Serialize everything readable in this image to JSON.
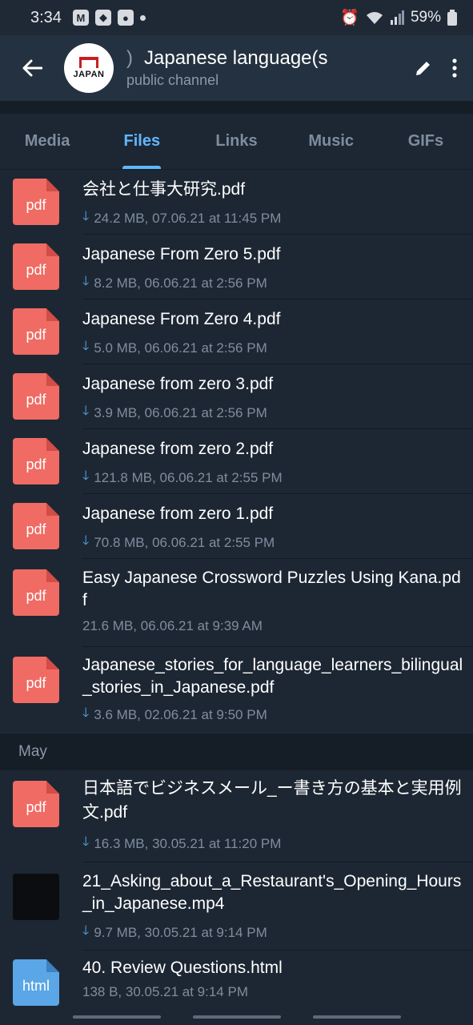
{
  "status": {
    "time": "3:34",
    "battery": "59%"
  },
  "channel": {
    "avatar_text": "JAPAN",
    "title_prefix": ")",
    "title": "Japanese language(s",
    "subtitle": "public channel"
  },
  "tabs": [
    {
      "label": "Media"
    },
    {
      "label": "Files"
    },
    {
      "label": "Links"
    },
    {
      "label": "Music"
    },
    {
      "label": "GIFs"
    }
  ],
  "files": [
    {
      "name": "会社と仕事大研究.pdf",
      "meta": "24.2 MB, 07.06.21 at 11:45 PM",
      "icon": "pdf"
    },
    {
      "name": "Japanese From Zero 5.pdf",
      "meta": "8.2 MB, 06.06.21 at 2:56 PM",
      "icon": "pdf"
    },
    {
      "name": "Japanese From Zero 4.pdf",
      "meta": "5.0 MB, 06.06.21 at 2:56 PM",
      "icon": "pdf"
    },
    {
      "name": "Japanese from zero 3.pdf",
      "meta": "3.9 MB, 06.06.21 at 2:56 PM",
      "icon": "pdf"
    },
    {
      "name": "Japanese from zero 2.pdf",
      "meta": "121.8 MB, 06.06.21 at 2:55 PM",
      "icon": "pdf"
    },
    {
      "name": "Japanese from zero 1.pdf",
      "meta": "70.8 MB, 06.06.21 at 2:55 PM",
      "icon": "pdf"
    },
    {
      "name": "Easy Japanese Crossword Puzzles Using Kana.pdf",
      "meta": "21.6 MB, 06.06.21 at 9:39 AM",
      "icon": "pdf"
    },
    {
      "name": "Japanese_stories_for_language_learners_bilingual_stories_in_Japanese.pdf",
      "meta": "3.6 MB, 02.06.21 at 9:50 PM",
      "icon": "pdf"
    }
  ],
  "section_may": "May",
  "files_may": [
    {
      "name": "日本語でビジネスメール_ー書き方の基本と実用例文.pdf",
      "meta": "16.3 MB, 30.05.21 at 11:20 PM",
      "icon": "pdf"
    },
    {
      "name": "21_Asking_about_a_Restaurant's_Opening_Hours_in_Japanese.mp4",
      "meta": "9.7 MB, 30.05.21 at 9:14 PM",
      "icon": "video"
    },
    {
      "name": "40. Review Questions.html",
      "meta": "138 B, 30.05.21 at 9:14 PM",
      "icon": "html"
    }
  ],
  "icon_labels": {
    "pdf": "pdf",
    "html": "html"
  },
  "colors": {
    "accent": "#5fb7ff",
    "pdf": "#ef6b63",
    "html": "#5aa6e6",
    "background": "#1d2733"
  }
}
